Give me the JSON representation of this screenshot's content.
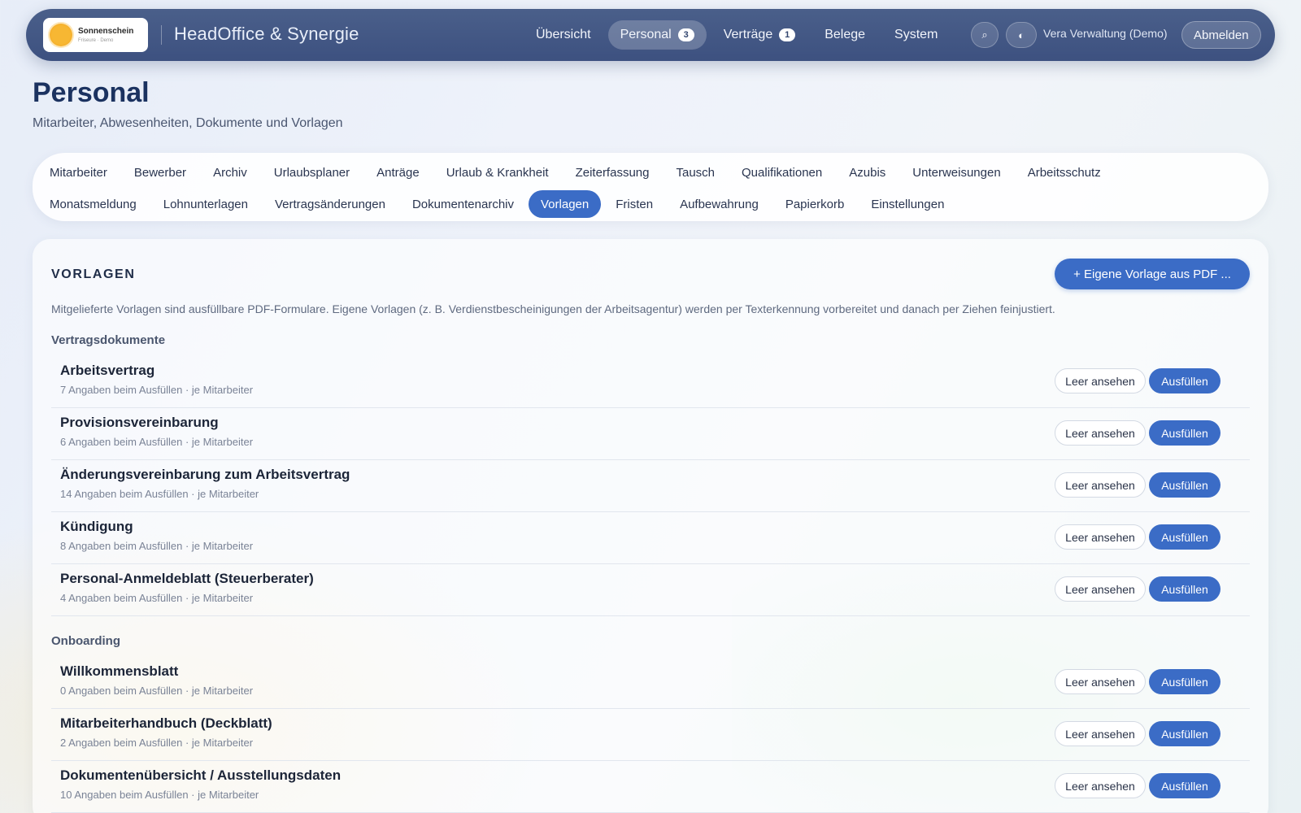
{
  "brand": {
    "logo_name": "Sonnenschein",
    "logo_sub": "Friseure · Demo",
    "title": "HeadOffice & Synergie"
  },
  "nav": {
    "items": [
      {
        "label": "Übersicht",
        "badge": ""
      },
      {
        "label": "Personal",
        "badge": "3"
      },
      {
        "label": "Verträge",
        "badge": "1"
      },
      {
        "label": "Belege",
        "badge": ""
      },
      {
        "label": "System",
        "badge": ""
      }
    ],
    "search_icon": "⌕",
    "theme_icon": "◐",
    "user": "Vera Verwaltung (Demo)",
    "logout": "Abmelden"
  },
  "page": {
    "title": "Personal",
    "subtitle": "Mitarbeiter, Abwesenheiten, Dokumente und Vorlagen"
  },
  "tabs": {
    "row1": [
      "Mitarbeiter",
      "Bewerber",
      "Archiv",
      "Urlaubsplaner",
      "Anträge",
      "Urlaub & Krankheit",
      "Zeiterfassung",
      "Tausch",
      "Qualifikationen",
      "Azubis",
      "Unterweisungen",
      "Arbeitsschutz"
    ],
    "row2": [
      "Monatsmeldung",
      "Lohnunterlagen",
      "Vertragsänderungen",
      "Dokumentenarchiv",
      "Vorlagen",
      "Fristen",
      "Aufbewahrung",
      "Papierkorb",
      "Einstellungen"
    ],
    "active": "Vorlagen"
  },
  "vorlagen": {
    "section_title": "VORLAGEN",
    "own_template_label": "+ Eigene Vorlage aus PDF ...",
    "intro": "Mitgelieferte Vorlagen sind ausfüllbare PDF-Formulare. Eigene Vorlagen (z. B. Verdienstbescheinigungen der Arbeitsagentur) werden per Texterkennung vorbereitet und danach per Ziehen feinjustiert.",
    "view_label": "Leer ansehen",
    "fill_label": "Ausfüllen",
    "groups": [
      {
        "label": "Vertragsdokumente",
        "items": [
          {
            "title": "Arbeitsvertrag",
            "meta": "7 Angaben beim Ausfüllen · je Mitarbeiter"
          },
          {
            "title": "Provisionsvereinbarung",
            "meta": "6 Angaben beim Ausfüllen · je Mitarbeiter"
          },
          {
            "title": "Änderungsvereinbarung zum Arbeitsvertrag",
            "meta": "14 Angaben beim Ausfüllen · je Mitarbeiter"
          },
          {
            "title": "Kündigung",
            "meta": "8 Angaben beim Ausfüllen · je Mitarbeiter"
          },
          {
            "title": "Personal-Anmeldeblatt (Steuerberater)",
            "meta": "4 Angaben beim Ausfüllen · je Mitarbeiter"
          }
        ]
      },
      {
        "label": "Onboarding",
        "items": [
          {
            "title": "Willkommensblatt",
            "meta": "0 Angaben beim Ausfüllen · je Mitarbeiter"
          },
          {
            "title": "Mitarbeiterhandbuch (Deckblatt)",
            "meta": "2 Angaben beim Ausfüllen · je Mitarbeiter"
          },
          {
            "title": "Dokumentenübersicht / Ausstellungsdaten",
            "meta": "10 Angaben beim Ausfüllen · je Mitarbeiter"
          }
        ]
      }
    ]
  }
}
